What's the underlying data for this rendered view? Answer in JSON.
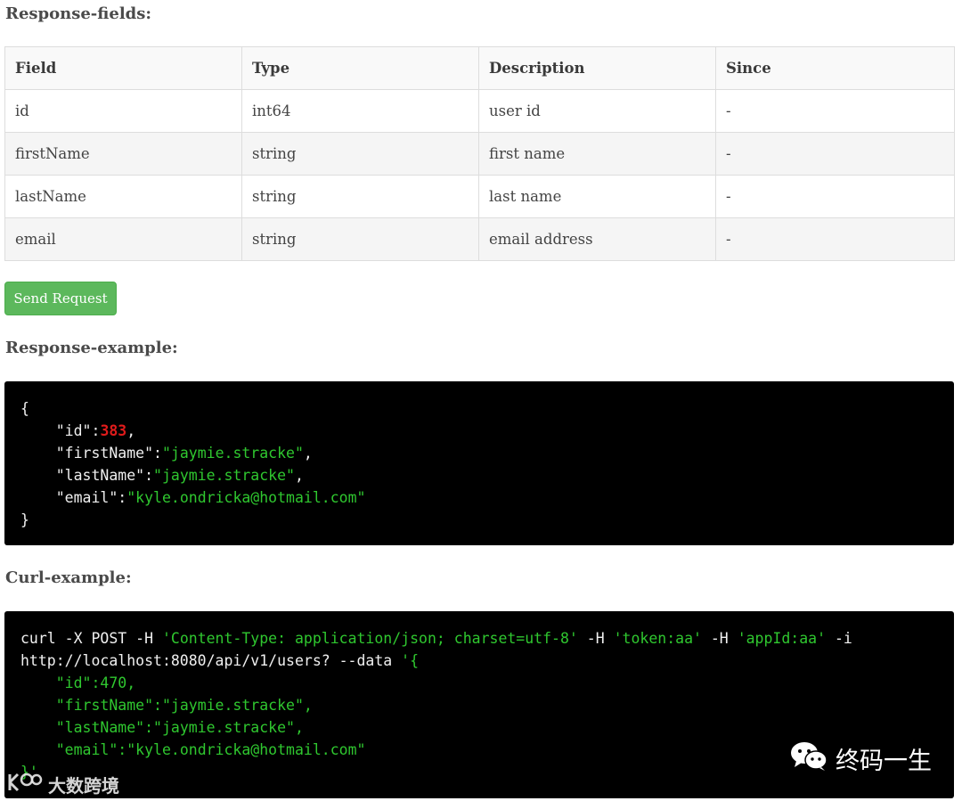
{
  "headings": {
    "fields": "Response-fields:",
    "response": "Response-example:",
    "curl": "Curl-example:"
  },
  "table": {
    "columns": [
      "Field",
      "Type",
      "Description",
      "Since"
    ],
    "rows": [
      [
        "id",
        "int64",
        "user id",
        "-"
      ],
      [
        "firstName",
        "string",
        "first name",
        "-"
      ],
      [
        "lastName",
        "string",
        "last name",
        "-"
      ],
      [
        "email",
        "string",
        "email address",
        "-"
      ]
    ]
  },
  "send_button": "Send Request",
  "response_example": {
    "open": "{",
    "close": "}",
    "id_key": "\"id\"",
    "id_value": "383",
    "first_key": "\"firstName\"",
    "first_value": "\"jaymie.stracke\"",
    "last_key": "\"lastName\"",
    "last_value": "\"jaymie.stracke\"",
    "email_key": "\"email\"",
    "email_value": "\"kyle.ondricka@hotmail.com\""
  },
  "curl_example": {
    "cmd_prefix": "curl -X POST -H ",
    "content_type": "'Content-Type: application/json; charset=utf-8'",
    "h1": " -H ",
    "token": "'token:aa'",
    "h2": " -H ",
    "appid": "'appId:aa'",
    "suffix": " -i",
    "url": "http://localhost:8080/api/v1/users? --data ",
    "data_open": "'{",
    "id_line": "\"id\":470,",
    "first_line": "\"firstName\":\"jaymie.stracke\",",
    "last_line": "\"lastName\":\"jaymie.stracke\",",
    "email_line": "\"email\":\"kyle.ondricka@hotmail.com\"",
    "data_close": "}'"
  },
  "watermarks": {
    "left": "大数跨境",
    "right": "终码一生"
  },
  "colors": {
    "button": "#5cb85c",
    "code_bg": "#000000",
    "string": "#2fc72f",
    "number": "#e01b1b"
  }
}
